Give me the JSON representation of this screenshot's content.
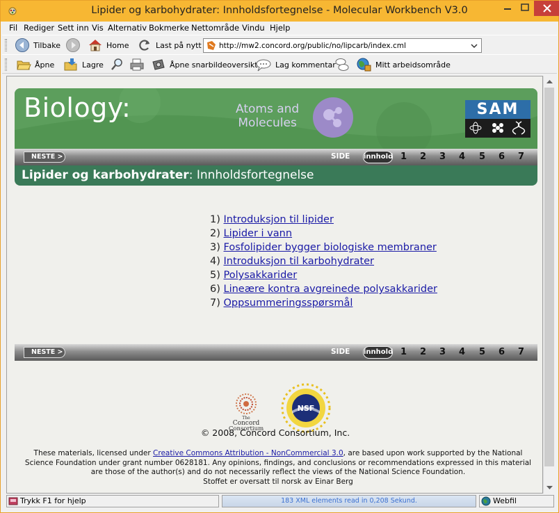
{
  "window": {
    "title": "Lipider og karbohydrater: Innholdsfortegnelse - Molecular Workbench V3.0"
  },
  "menu": [
    "Fil",
    "Rediger",
    "Sett inn",
    "Vis",
    "Alternativ",
    "Bokmerke",
    "Nettområde",
    "Vindu",
    "Hjelp"
  ],
  "toolbar1": {
    "back_label": "Tilbake",
    "home_label": "Home",
    "reload_label": "Last på nytt",
    "url": "http://mw2.concord.org/public/no/lipcarb/index.cml"
  },
  "toolbar2": {
    "open_label": "Åpne",
    "save_label": "Lagre",
    "snapshot_label": "Åpne snarbildeoversikt",
    "comment_label": "Lag kommentar",
    "workspace_label": "Mitt arbeidsområde"
  },
  "banner": {
    "biology": "Biology:",
    "atoms_line1": "Atoms and",
    "atoms_line2": "Molecules",
    "sam": "SAM"
  },
  "nav": {
    "next_label": "NESTE >",
    "side_label": "SIDE",
    "innhold_label": "innhold",
    "pages": [
      "1",
      "2",
      "3",
      "4",
      "5",
      "6",
      "7"
    ]
  },
  "heading": {
    "bold": "Lipider og karbohydrater",
    "rest": ": Innholdsfortegnelse"
  },
  "toc": [
    {
      "num": "1)",
      "title": "Introduksjon til lipider"
    },
    {
      "num": "2)",
      "title": "Lipider i vann"
    },
    {
      "num": "3)",
      "title": "Fosfolipider bygger biologiske membraner"
    },
    {
      "num": "4)",
      "title": "Introduksjon til karbohydrater"
    },
    {
      "num": "5)",
      "title": "Polysakkarider"
    },
    {
      "num": "6)",
      "title": "Lineære kontra avgreinede polysakkarider"
    },
    {
      "num": "7)",
      "title": "Oppsummeringsspørsmål"
    }
  ],
  "footer": {
    "concord_line1": "The",
    "concord_line2": "Concord",
    "concord_line3": "Consortium",
    "nsf": "NSF",
    "copyright": "© 2008, Concord Consortium, Inc.",
    "license_pre": "These materials, licensed under ",
    "license_link": "Creative Commons Attribution - NonCommercial 3.0",
    "license_post": ", are based upon work supported by the National Science Foundation under grant number 0628181. Any opinions, findings, and conclusions or recommendations expressed in this material are those of the author(s) and do not necessarily reflect the views of the National Science Foundation.",
    "translator": "Stoffet er oversatt til norsk av Einar Berg"
  },
  "status": {
    "help": "Trykk F1 for hjelp",
    "message": "183 XML elements read in 0,208 Sekund.",
    "mode": "Webfil"
  },
  "colors": {
    "titlebar": "#f7b733",
    "banner_green": "#5a9c5a",
    "heading_green": "#3a7a58",
    "link": "#1a1aa6"
  }
}
